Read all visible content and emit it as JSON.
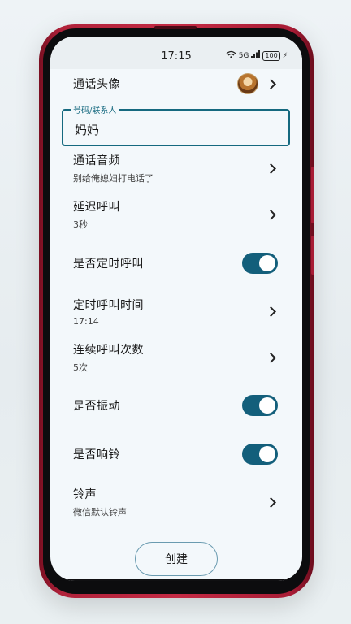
{
  "status": {
    "time": "17:15",
    "signal": "5G",
    "battery": "100"
  },
  "header": {
    "avatar_row_label": "通话头像"
  },
  "contact_field": {
    "label": "号码/联系人",
    "value": "妈妈"
  },
  "settings": [
    {
      "title": "通话音频",
      "subtitle": "别给俺媳妇打电话了"
    },
    {
      "title": "延迟呼叫",
      "subtitle": "3秒"
    },
    {
      "title": "是否定时呼叫",
      "toggle": true
    },
    {
      "title": "定时呼叫时间",
      "subtitle": "17:14"
    },
    {
      "title": "连续呼叫次数",
      "subtitle": "5次"
    },
    {
      "title": "是否振动",
      "toggle": true
    },
    {
      "title": "是否响铃",
      "toggle": true
    },
    {
      "title": "铃声",
      "subtitle": "微信默认铃声"
    }
  ],
  "actions": {
    "create_label": "创建"
  },
  "colors": {
    "accent": "#135f7b",
    "phone_frame": "#c42a44",
    "screen_bg": "#f3f8fb"
  }
}
